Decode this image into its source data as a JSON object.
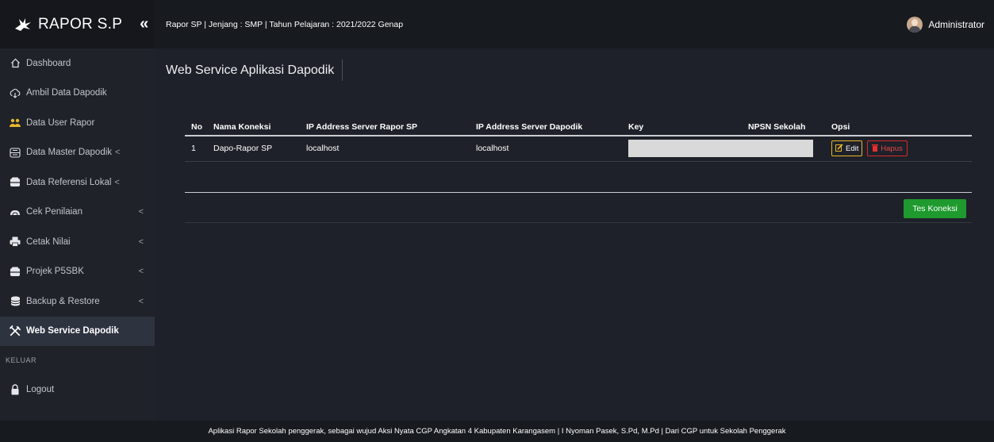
{
  "brand": {
    "title": "RAPOR S.P",
    "toggle": "«"
  },
  "topbar": {
    "info": "Rapor SP | Jenjang : SMP | Tahun Pelajaran : 2021/2022 Genap",
    "user": "Administrator"
  },
  "sidebar": {
    "items": [
      {
        "label": "Dashboard",
        "icon": "home-icon",
        "chevron": ""
      },
      {
        "label": "Ambil Data Dapodik",
        "icon": "cloud-download-icon",
        "chevron": ""
      },
      {
        "label": "Data User Rapor",
        "icon": "users-icon",
        "chevron": ""
      },
      {
        "label": "Data Master Dapodik",
        "icon": "database-icon",
        "chevron": "<"
      },
      {
        "label": "Data Referensi Lokal",
        "icon": "database-icon",
        "chevron": "<"
      },
      {
        "label": "Cek Penilaian",
        "icon": "cloud-icon",
        "chevron": "<"
      },
      {
        "label": "Cetak Nilai",
        "icon": "printer-icon",
        "chevron": "<"
      },
      {
        "label": "Projek P5SBK",
        "icon": "folder-icon",
        "chevron": "<"
      },
      {
        "label": "Backup & Restore",
        "icon": "database-stack-icon",
        "chevron": "<"
      },
      {
        "label": "Web Service Dapodik",
        "icon": "tools-icon",
        "chevron": ""
      }
    ],
    "section_keluar": "KELUAR",
    "logout": "Logout"
  },
  "main": {
    "title": "Web Service Aplikasi Dapodik",
    "table": {
      "headers": [
        "No",
        "Nama Koneksi",
        "IP Address Server Rapor SP",
        "IP Address Server Dapodik",
        "Key",
        "NPSN Sekolah",
        "Opsi"
      ],
      "rows": [
        {
          "no": "1",
          "nama": "Dapo-Rapor SP",
          "ip_rapor": "localhost",
          "ip_dapodik": "localhost",
          "key": "",
          "npsn": ""
        }
      ]
    },
    "edit_label": "Edit",
    "hapus_label": "Hapus",
    "tes_label": "Tes Koneksi"
  },
  "footer": {
    "text": "Aplikasi Rapor Sekolah penggerak, sebagai wujud Aksi Nyata CGP Angkatan 4 Kabupaten Karangasem | I Nyoman Pasek, S.Pd, M.Pd | Dari CGP untuk Sekolah Penggerak"
  },
  "colors": {
    "background": "#1e2129",
    "sidebar_active": "#2e3340",
    "edit_border": "#e8b62c",
    "hapus_border": "#d92a2a",
    "tes_button": "#1e9a2e"
  }
}
